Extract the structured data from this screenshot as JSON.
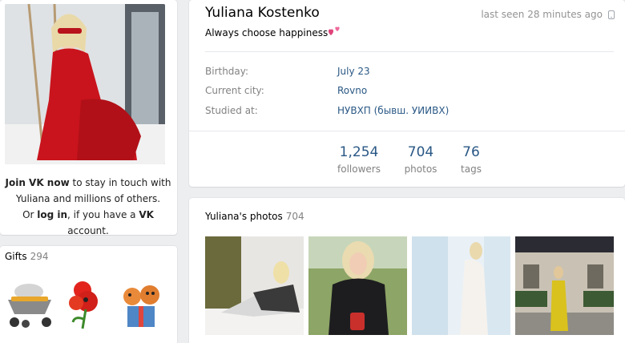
{
  "profile": {
    "name": "Yuliana Kostenko",
    "status": "Always choose happiness",
    "last_seen": "last seen 28 minutes ago"
  },
  "info": [
    {
      "label": "Birthday:",
      "value": "July 23"
    },
    {
      "label": "Current city:",
      "value": "Rovno"
    },
    {
      "label": "Studied at:",
      "value": "НУВХП (бывш. УИИВХ)"
    }
  ],
  "counters": [
    {
      "num": "1,254",
      "label": "followers"
    },
    {
      "num": "704",
      "label": "photos"
    },
    {
      "num": "76",
      "label": "tags"
    }
  ],
  "join": {
    "join_link": "Join VK now",
    "line1_rest": " to stay in touch with",
    "line2": "Yuliana and millions of others.",
    "or": "Or ",
    "login_link": "log in",
    "line3_mid": ", if you have a ",
    "vk": "VK",
    "line3_end": " account."
  },
  "gifts": {
    "title": "Gifts",
    "count": "294"
  },
  "photos": {
    "title": "Yuliana's photos",
    "count": "704"
  },
  "colors": {
    "link": "#2a5885",
    "muted": "#828282",
    "bg": "#edeef0"
  }
}
